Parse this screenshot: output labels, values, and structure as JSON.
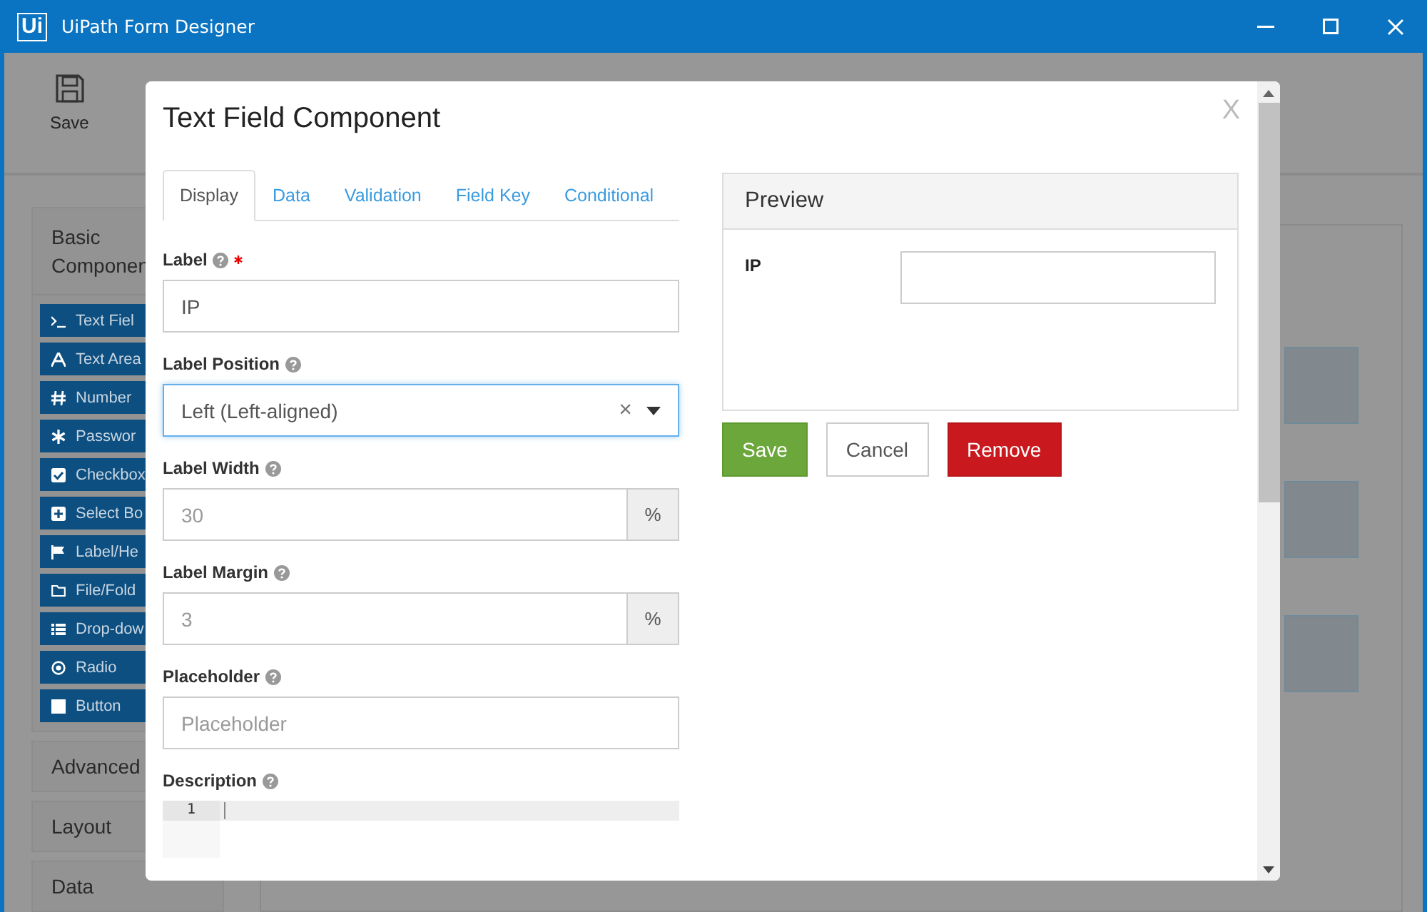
{
  "window": {
    "title": "UiPath Form Designer",
    "logo": "Ui"
  },
  "toolbar": [
    {
      "label": "Save"
    }
  ],
  "sidebar": {
    "groups": [
      {
        "title": "Basic Componen",
        "items": [
          {
            "label": "Text Fiel",
            "kind": "terminal"
          },
          {
            "label": "Text Area",
            "kind": "letter"
          },
          {
            "label": "Number",
            "kind": "hash"
          },
          {
            "label": "Passwor",
            "kind": "asterisk"
          },
          {
            "label": "Checkbox",
            "kind": "check"
          },
          {
            "label": "Select Bo",
            "kind": "plus"
          },
          {
            "label": "Label/He",
            "kind": "flag"
          },
          {
            "label": "File/Fold",
            "kind": "folder"
          },
          {
            "label": "Drop-dow",
            "kind": "list"
          },
          {
            "label": "Radio",
            "kind": "radio"
          },
          {
            "label": "Button",
            "kind": "square"
          }
        ]
      },
      {
        "title": "Advanced"
      },
      {
        "title": "Layout"
      },
      {
        "title": "Data"
      }
    ]
  },
  "dialog": {
    "title": "Text Field Component",
    "close": "X",
    "tabs": [
      {
        "label": "Display",
        "selected": true
      },
      {
        "label": "Data",
        "selected": false
      },
      {
        "label": "Validation",
        "selected": false
      },
      {
        "label": "Field Key",
        "selected": false
      },
      {
        "label": "Conditional",
        "selected": false
      }
    ],
    "fields": [
      {
        "kind": "text",
        "label": "Label",
        "required": true,
        "value": "IP"
      },
      {
        "kind": "select",
        "label": "Label Position",
        "value": "Left (Left-aligned)",
        "clear": "×"
      },
      {
        "kind": "addon",
        "label": "Label Width",
        "placeholder": "30",
        "addon": "%"
      },
      {
        "kind": "addon",
        "label": "Label Margin",
        "placeholder": "3",
        "addon": "%"
      },
      {
        "kind": "text",
        "label": "Placeholder",
        "placeholder": "Placeholder"
      },
      {
        "kind": "editor",
        "label": "Description",
        "line": "1"
      }
    ],
    "preview": {
      "title": "Preview",
      "field_label": "IP"
    },
    "buttons": [
      {
        "label": "Save",
        "kind": "success"
      },
      {
        "label": "Cancel",
        "kind": "default"
      },
      {
        "label": "Remove",
        "kind": "danger"
      }
    ]
  }
}
